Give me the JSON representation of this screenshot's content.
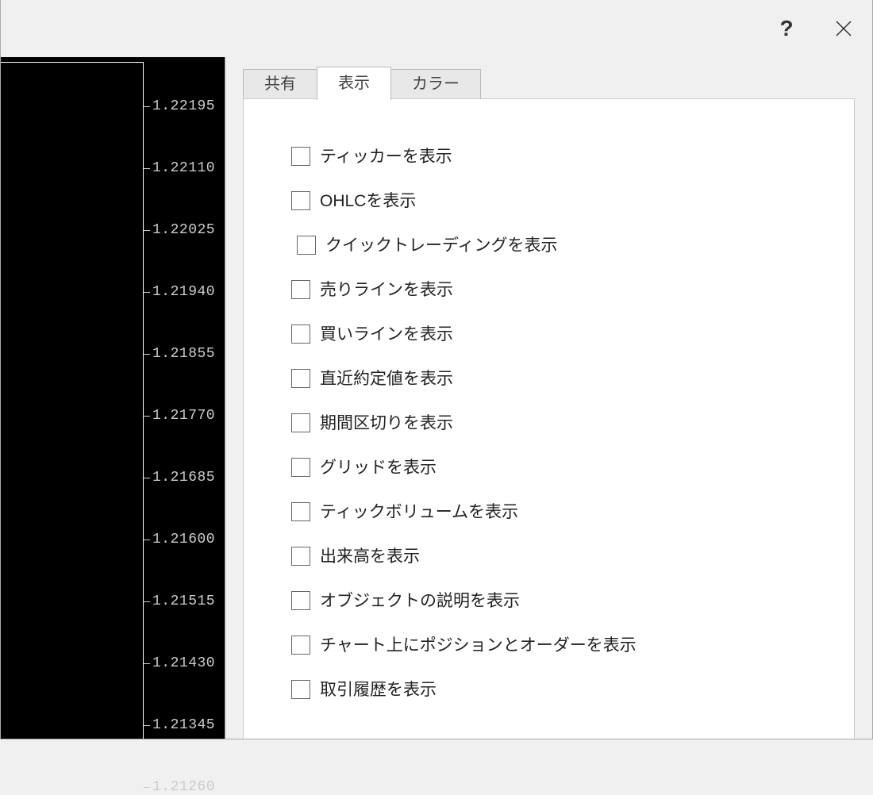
{
  "titlebar": {
    "help": "?"
  },
  "chart": {
    "ticks": [
      "1.22195",
      "1.22110",
      "1.22025",
      "1.21940",
      "1.21855",
      "1.21770",
      "1.21685",
      "1.21600",
      "1.21515",
      "1.21430",
      "1.21345",
      "1.21260"
    ]
  },
  "tabs": {
    "items": [
      {
        "label": "共有",
        "active": false
      },
      {
        "label": "表示",
        "active": true
      },
      {
        "label": "カラー",
        "active": false
      }
    ]
  },
  "options": [
    {
      "label": "ティッカーを表示",
      "indent": false
    },
    {
      "label": "OHLCを表示",
      "indent": false
    },
    {
      "label": "クイックトレーディングを表示",
      "indent": true
    },
    {
      "label": "売りラインを表示",
      "indent": false
    },
    {
      "label": "買いラインを表示",
      "indent": false
    },
    {
      "label": "直近約定値を表示",
      "indent": false
    },
    {
      "label": "期間区切りを表示",
      "indent": false
    },
    {
      "label": "グリッドを表示",
      "indent": false
    },
    {
      "label": "ティックボリュームを表示",
      "indent": false
    },
    {
      "label": "出来高を表示",
      "indent": false
    },
    {
      "label": "オブジェクトの説明を表示",
      "indent": false
    },
    {
      "label": "チャート上にポジションとオーダーを表示",
      "indent": false
    },
    {
      "label": "取引履歴を表示",
      "indent": false
    }
  ]
}
